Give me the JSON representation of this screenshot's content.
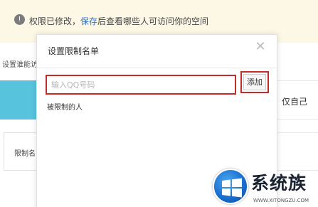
{
  "notice": {
    "icon": "info-icon",
    "prefix": "权限已修改，",
    "link": "保存",
    "suffix": "后查看哪些人可访问你的空间"
  },
  "background": {
    "section_label": "设置谁能访",
    "right_option": "仅自己",
    "box_label": "限制名"
  },
  "modal": {
    "title": "设置限制名单",
    "close_icon": "close-icon",
    "input_placeholder": "输入QQ号码",
    "input_value": "",
    "add_button": "添加",
    "restricted_label": "被限制的人"
  },
  "watermark": {
    "brand": "系统族",
    "url": "WWW.XITONGZU.COM",
    "icon": "windows-logo-icon"
  },
  "colors": {
    "notice_bg": "#fdf8e5",
    "link": "#2f73c8",
    "highlight_border": "#c42b2b",
    "accent_teal": "#57c3dd"
  }
}
